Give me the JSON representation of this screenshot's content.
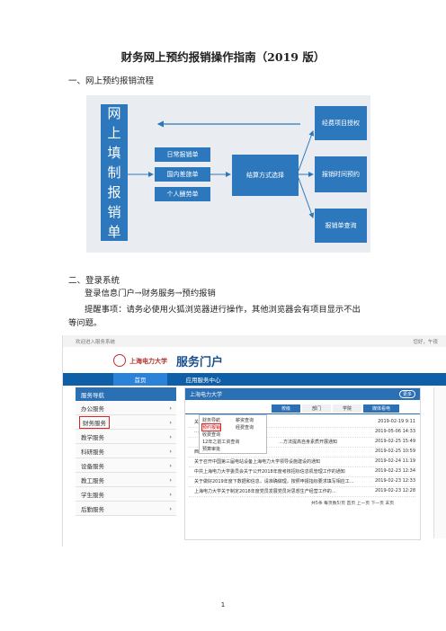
{
  "doc": {
    "title": "财务网上预约报销操作指南（2019 版）",
    "section1": "一、网上预约报销流程",
    "section2": "二、登录系统",
    "path_text": "登录信息门户→财务服务→预约报销",
    "note_line1": "提醒事项：请务必使用火狐浏览器进行操作，其他浏览器会有项目显示不出",
    "note_line2": "等问题。",
    "page_number": "1"
  },
  "flow": {
    "left_block": [
      "网",
      "上",
      "填",
      "制",
      "报",
      "销",
      "单"
    ],
    "middle_items": [
      "日常报销单",
      "国内差旅单",
      "个人酬劳单"
    ],
    "center": "结算方式选择",
    "right_items": [
      "经费项目授权",
      "报销时间预约",
      "报销单查询"
    ]
  },
  "portal": {
    "topbar_left": "欢迎进入服务系统",
    "topbar_right": "您好，午夜",
    "school_name": "上海电力大学",
    "portal_title": "服务门户",
    "nav": [
      "首页",
      "应用服务中心"
    ],
    "side_header": "服务导航",
    "side_items": [
      "办公服务",
      "财务服务",
      "教学服务",
      "科研服务",
      "设备服务",
      "教工服务",
      "学生服务",
      "后勤服务"
    ],
    "main_header": "上海电力大学",
    "main_header_right": "更多",
    "tabs": [
      "校级",
      "部门",
      "学院",
      "媒体看电"
    ],
    "popup": {
      "col1": [
        "财务导航",
        "预约报销",
        "收费查询",
        "12年之前工资查询",
        "预算审批"
      ],
      "col2": [
        "薪资查询",
        "经费查询"
      ]
    },
    "rows": [
      {
        "title": "关于…通知",
        "date": "2019-02-19 9:11"
      },
      {
        "title": "…",
        "date": "2019-05-06 14:33"
      },
      {
        "title": "…方法提高自身素质开展通知",
        "date": "2019-02-25 15:49"
      },
      {
        "title": "西藏日报（第）公示",
        "date": "2019-02-25 10:59"
      },
      {
        "title": "关于召开中国第三届电站设备上海电力大学领导设施建设的通知",
        "date": "2019-02-24 11:19"
      },
      {
        "title": "中共上海电力大学委员会关于公开2018年度考核招标信息机管理工作的通知",
        "date": "2019-02-23 12:34"
      },
      {
        "title": "关于做好2019年度下数据和信息，请准确做理，按照申报指标要求填写相应工…",
        "date": "2019-02-23 12:33"
      },
      {
        "title": "上海电力大学关于制定2018年度党员发展党员对思想生产经营工作的…",
        "date": "2019-02-23 12:28"
      }
    ],
    "pager": "共5条 每页数5/页 首页 上一页 下一页 末页"
  }
}
